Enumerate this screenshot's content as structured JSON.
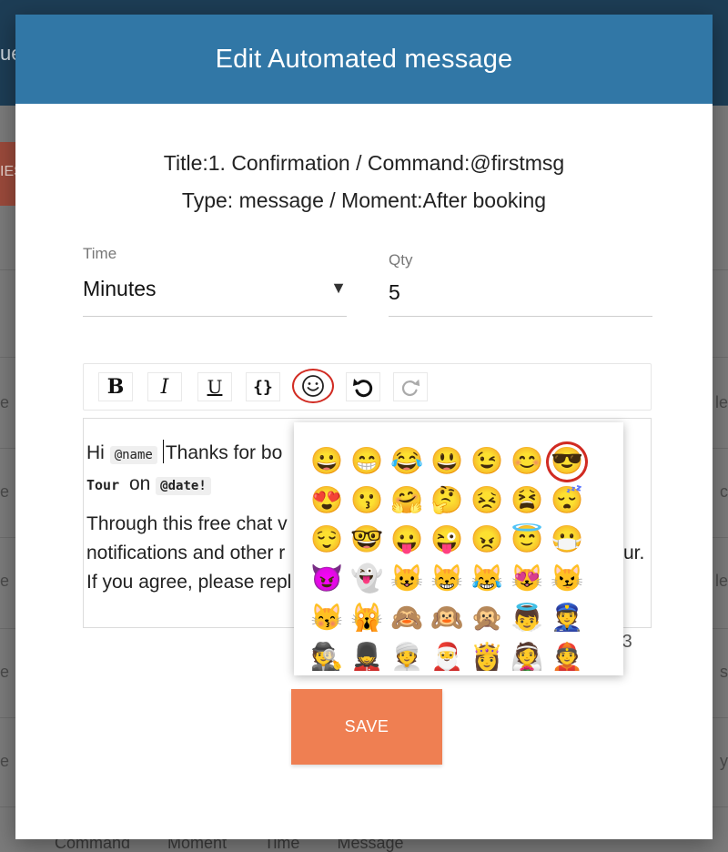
{
  "background": {
    "topbar_text": "ue",
    "red_button_text": "IES",
    "left_row_fragments": [
      "e",
      "e",
      "e",
      "e",
      "e",
      "e"
    ],
    "right_row_fragments": [
      "le",
      "c",
      "le",
      "s",
      "y"
    ],
    "footer_columns": [
      "Command",
      "Moment",
      "Time",
      "Message"
    ]
  },
  "modal": {
    "title": "Edit Automated message",
    "info_line1": "Title:1. Confirmation / Command:@firstmsg",
    "info_line2": "Type: message / Moment:After booking",
    "time": {
      "label": "Time",
      "value": "Minutes"
    },
    "qty": {
      "label": "Qty",
      "value": "5"
    },
    "toolbar": {
      "bold": "B",
      "italic": "I",
      "underline": "U",
      "braces": "{}",
      "emoji": "emoji-icon",
      "undo": "undo-icon",
      "redo": "redo-icon"
    },
    "editor": {
      "hi": "Hi",
      "tag_name": "@name",
      "thanks": "Thanks for bo",
      "tour": "Tour",
      "on": "on",
      "tag_date": "@date!",
      "line3": "Through this free chat v",
      "line4a": "notifications and other r",
      "line4b": "ur.",
      "line5": "If you agree, please repl"
    },
    "counter": "7/3",
    "save_label": "SAVE"
  },
  "emoji_picker": {
    "emojis": [
      "😀",
      "😁",
      "😂",
      "😃",
      "😉",
      "😊",
      "😎",
      "😍",
      "😗",
      "🤗",
      "🤔",
      "😣",
      "😫",
      "😴",
      "😌",
      "🤓",
      "😛",
      "😜",
      "😠",
      "😇",
      "😷",
      "😈",
      "👻",
      "😺",
      "😸",
      "😹",
      "😻",
      "😼",
      "😽",
      "🙀",
      "🙈",
      "🙉",
      "🙊",
      "👼",
      "👮",
      "🕵",
      "💂",
      "👳",
      "🎅",
      "👸",
      "👰",
      "👲"
    ],
    "selected_index": 6
  },
  "colors": {
    "header": "#3177a6",
    "save": "#ef7f52",
    "highlight": "#d12b22"
  }
}
